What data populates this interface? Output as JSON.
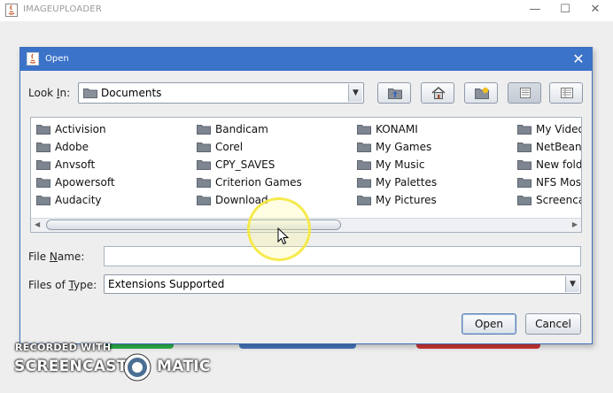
{
  "app": {
    "title": "IMAGEUPLOADER",
    "controls": {
      "minimize": "—",
      "maximize": "☐",
      "close": "✕"
    },
    "hidden_buttons": [
      {
        "color": "#2fb34a"
      },
      {
        "color": "#4a78c0"
      },
      {
        "color": "#cf3535"
      }
    ]
  },
  "dialog": {
    "title": "Open",
    "close_symbol": "✕",
    "look_in": {
      "label_pre": "Look ",
      "label_mnemonic": "I",
      "label_post": "n:",
      "value": "Documents"
    },
    "toolbar": [
      {
        "name": "up-one-level-button",
        "icon": "folder-up-icon",
        "selected": false
      },
      {
        "name": "home-button",
        "icon": "home-icon",
        "selected": false
      },
      {
        "name": "new-folder-button",
        "icon": "new-folder-icon",
        "selected": false
      },
      {
        "name": "list-view-button",
        "icon": "list-view-icon",
        "selected": true
      },
      {
        "name": "details-view-button",
        "icon": "details-view-icon",
        "selected": false
      }
    ],
    "files": {
      "col1": [
        "Activision",
        "Adobe",
        "Anvsoft",
        "Apowersoft",
        "Audacity"
      ],
      "col2": [
        "Bandicam",
        "Corel",
        "CPY_SAVES",
        "Criterion Games",
        "Download"
      ],
      "col3": [
        "KONAMI",
        "My Games",
        "My Music",
        "My Palettes",
        "My Pictures"
      ],
      "col4": [
        "My Videos",
        "NetBeans",
        "New folde",
        "NFS Most",
        "Screenca"
      ]
    },
    "file_name": {
      "label_pre": "File ",
      "label_mnemonic": "N",
      "label_post": "ame:",
      "value": ""
    },
    "files_of_type": {
      "label_pre": "Files of ",
      "label_mnemonic": "T",
      "label_post": "ype:",
      "value": "Extensions Supported"
    },
    "buttons": {
      "open": "Open",
      "cancel": "Cancel"
    }
  },
  "watermark": {
    "line1": "RECORDED WITH",
    "line2a": "SCREENCAST",
    "line2b": "MATIC"
  },
  "colors": {
    "dialog_title_bar": "#3b73c9",
    "folder": "#7d8590",
    "highlight_ring": "#f5e83c"
  }
}
